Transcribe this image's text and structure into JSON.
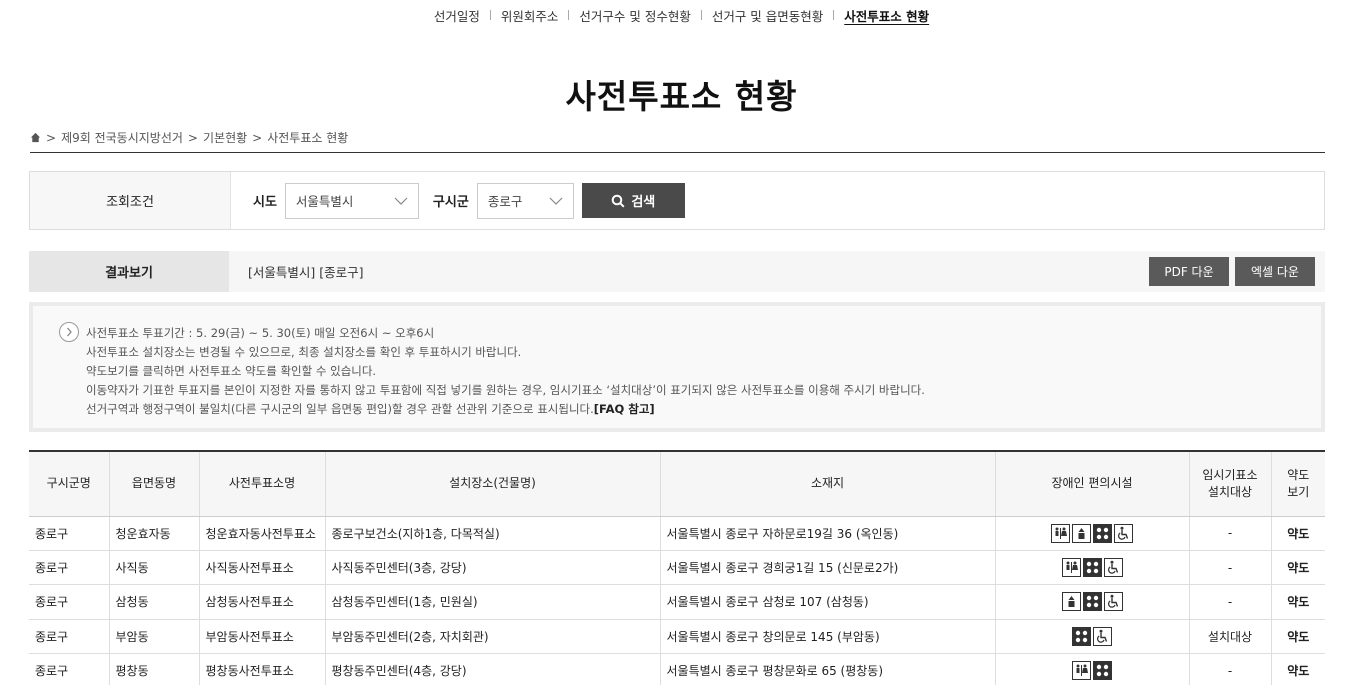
{
  "nav": {
    "items": [
      "선거일정",
      "위원회주소",
      "선거구수 및 정수현황",
      "선거구 및 읍면동현황",
      "사전투표소 현황"
    ],
    "active_index": 4
  },
  "page_title": "사전투표소 현황",
  "breadcrumb": {
    "home_icon": "home-icon",
    "items": [
      "제9회 전국동시지방선거",
      "기본현황",
      "사전투표소 현황"
    ],
    "separator": ">"
  },
  "search": {
    "label": "조회조건",
    "sido_label": "시도",
    "sido_value": "서울특별시",
    "gusigun_label": "구시군",
    "gusigun_value": "종로구",
    "button_label": "검색"
  },
  "result": {
    "label": "결과보기",
    "text": "[서울특별시] [종로구]",
    "pdf_label": "PDF 다운",
    "excel_label": "엑셀 다운"
  },
  "notice": {
    "lines": [
      "사전투표소 투표기간 : 5. 29(금) ~ 5. 30(토) 매일 오전6시 ~ 오후6시",
      "사전투표소 설치장소는 변경될 수 있으므로, 최종 설치장소를 확인 후 투표하시기 바랍니다.",
      "약도보기를 클릭하면 사전투표소 약도를 확인할 수 있습니다.",
      "이동약자가 기표한 투표지를 본인이 지정한 자를 통하지 않고 투표함에 직접 넣기를 원하는 경우, 임시기표소 ‘설치대상’이 표기되지 않은 사전투표소를 이용해 주시기 바랍니다.",
      "선거구역과 행정구역이 불일치(다른 구시군의 일부 읍면동 편입)할 경우 관할 선관위 기준으로 표시됩니다."
    ],
    "faq_label": "[FAQ 참고]"
  },
  "table": {
    "headers": [
      "구시군명",
      "읍면동명",
      "사전투표소명",
      "설치장소(건물명)",
      "소재지",
      "장애인 편의시설",
      "임시기표소 설치대상",
      "약도 보기"
    ],
    "rows": [
      {
        "gu": "종로구",
        "dong": "청운효자동",
        "name": "청운효자동사전투표소",
        "place": "종로구보건소(지하1층, 다목적실)",
        "addr": "서울특별시 종로구 자하문로19길 36 (옥인동)",
        "icons": [
          "restroom-icon",
          "elevator-icon",
          "braille-icon",
          "wheelchair-icon"
        ],
        "temp": "-",
        "map": "약도"
      },
      {
        "gu": "종로구",
        "dong": "사직동",
        "name": "사직동사전투표소",
        "place": "사직동주민센터(3층, 강당)",
        "addr": "서울특별시 종로구 경희궁1길 15 (신문로2가)",
        "icons": [
          "restroom-icon",
          "braille-icon",
          "wheelchair-icon"
        ],
        "temp": "-",
        "map": "약도"
      },
      {
        "gu": "종로구",
        "dong": "삼청동",
        "name": "삼청동사전투표소",
        "place": "삼청동주민센터(1층, 민원실)",
        "addr": "서울특별시 종로구 삼청로 107 (삼청동)",
        "icons": [
          "elevator-icon",
          "braille-icon",
          "wheelchair-icon"
        ],
        "temp": "-",
        "map": "약도"
      },
      {
        "gu": "종로구",
        "dong": "부암동",
        "name": "부암동사전투표소",
        "place": "부암동주민센터(2층, 자치회관)",
        "addr": "서울특별시 종로구 창의문로 145 (부암동)",
        "icons": [
          "braille-icon",
          "wheelchair-icon"
        ],
        "temp": "설치대상",
        "map": "약도"
      },
      {
        "gu": "종로구",
        "dong": "평창동",
        "name": "평창동사전투표소",
        "place": "평창동주민센터(4층, 강당)",
        "addr": "서울특별시 종로구 평창문화로 65 (평창동)",
        "icons": [
          "restroom-icon",
          "braille-icon"
        ],
        "temp": "-",
        "map": "약도"
      }
    ]
  }
}
